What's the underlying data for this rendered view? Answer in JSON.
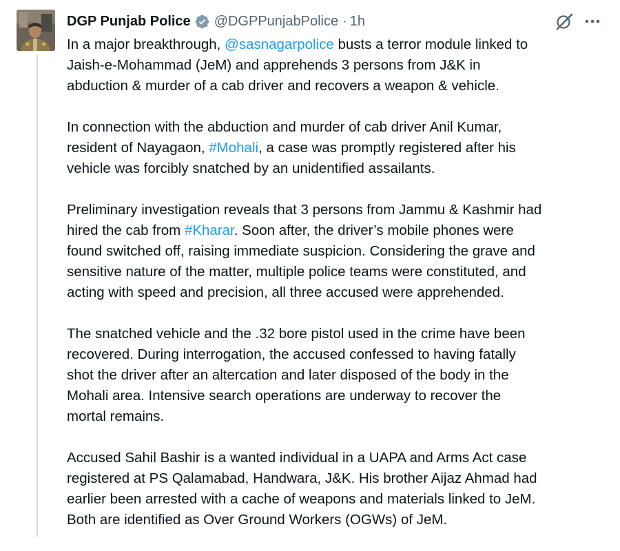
{
  "post": {
    "author": {
      "display_name": "DGP Punjab Police",
      "handle": "@DGPPunjabPolice",
      "separator": "·",
      "timestamp": "1h",
      "verified_color": "#829aab"
    },
    "icons": {
      "avatar": "profile-photo",
      "verified": "verified-badge-icon",
      "grok": "grok-icon",
      "more": "more-icon"
    },
    "paragraphs": [
      {
        "lines": [
          {
            "pre": "In a major breakthrough, ",
            "link": "@sasnagarpolice",
            "post": " busts a terror module linked to"
          },
          {
            "text": "Jaish-e-Mohammad (JeM) and apprehends 3 persons from J&K in"
          },
          {
            "text": "abduction & murder of a cab driver and recovers a weapon & vehicle."
          }
        ]
      },
      {
        "lines": [
          {
            "text": "In connection with the abduction and murder of cab driver Anil Kumar,"
          },
          {
            "pre": "resident of Nayagaon, ",
            "link": "#Mohali",
            "post": ", a case was promptly registered after his"
          },
          {
            "text": "vehicle was forcibly snatched by an unidentified assailants."
          }
        ]
      },
      {
        "lines": [
          {
            "text": "Preliminary investigation reveals that 3 persons from Jammu & Kashmir had"
          },
          {
            "pre": "hired the cab from ",
            "link": "#Kharar",
            "post": ". Soon after, the driver’s mobile phones were"
          },
          {
            "text": "found switched off, raising immediate suspicion. Considering the grave and"
          },
          {
            "text": "sensitive nature of the matter, multiple police teams were constituted, and"
          },
          {
            "text": "acting with speed and precision, all three accused were apprehended."
          }
        ]
      },
      {
        "lines": [
          {
            "text": "The snatched vehicle and the .32 bore pistol used in the crime have been"
          },
          {
            "text": "recovered. During interrogation, the accused confessed to having fatally"
          },
          {
            "text": "shot the driver after an altercation and later disposed of the body in the"
          },
          {
            "text": "Mohali area. Intensive search operations are underway to recover the"
          },
          {
            "text": "mortal remains."
          }
        ]
      },
      {
        "lines": [
          {
            "text": "Accused Sahil Bashir is a wanted individual in a UAPA and Arms Act case"
          },
          {
            "text": "registered at PS Qalamabad, Handwara, J&K. His brother Aijaz Ahmad had"
          },
          {
            "text": "earlier been arrested with a cache of weapons and materials linked to JeM."
          },
          {
            "text": "Both are identified as Over Ground Workers (OGWs) of JeM."
          }
        ]
      }
    ],
    "colors": {
      "text": "#0f1419",
      "secondary": "#536471",
      "link": "#1d9bf0",
      "thread_line": "#cfd9de"
    }
  }
}
